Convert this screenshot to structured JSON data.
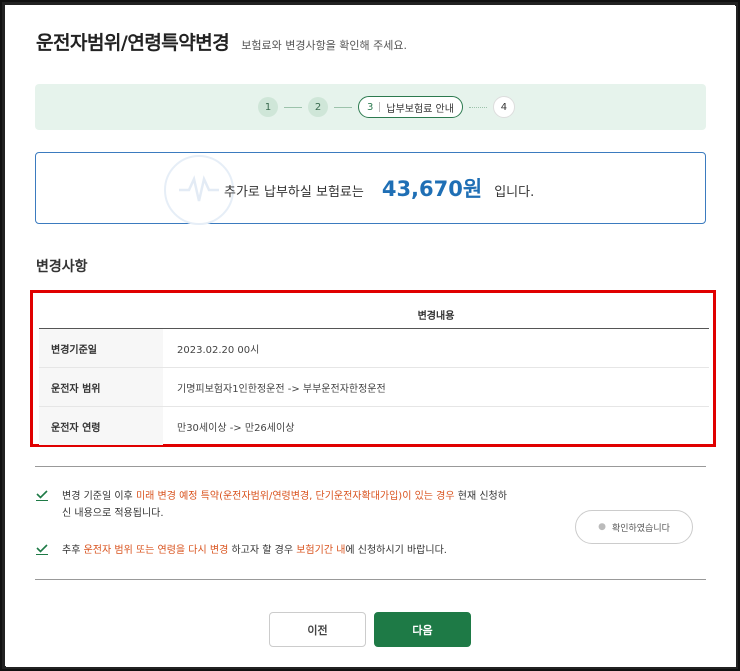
{
  "header": {
    "title": "운전자범위/연령특약변경",
    "subtitle": "보험료와 변경사항을 확인해 주세요."
  },
  "steps": {
    "step1": "1",
    "step2": "2",
    "step3_num": "3",
    "step3_label": "납부보험료 안내",
    "step4": "4"
  },
  "amount": {
    "prefix": "추가로 납부하실 보험료는",
    "value": "43,670원",
    "suffix": "입니다."
  },
  "changes": {
    "section_title": "변경사항",
    "column_header": "변경내용",
    "rows": [
      {
        "label": "변경기준일",
        "value": "2023.02.20 00시"
      },
      {
        "label": "운전자 범위",
        "value": "기명피보험자1인한정운전 -> 부부운전자한정운전"
      },
      {
        "label": "운전자 연령",
        "value": "만30세이상 -> 만26세이상"
      }
    ]
  },
  "notices": {
    "n1_a": "변경 기준일 이후 ",
    "n1_hl": "미래 변경 예정 특약(운전자범위/연령변경, 단기운전자확대가입)이 있는 경우",
    "n1_b": " 현재 신청하신 내용으로 적용됩니다.",
    "n2_a": "추후 ",
    "n2_hl1": "운전자 범위 또는 연령을 다시 변경",
    "n2_b": " 하고자 할 경우 ",
    "n2_hl2": "보험기간 내",
    "n2_c": "에 신청하시기 바랍니다."
  },
  "buttons": {
    "confirm": "확인하였습니다",
    "prev": "이전",
    "next": "다음"
  },
  "colors": {
    "accent_green": "#1e7a46",
    "amount_blue": "#1f6fb5",
    "highlight_orange": "#d9531e",
    "annotation_red": "#e00000"
  }
}
